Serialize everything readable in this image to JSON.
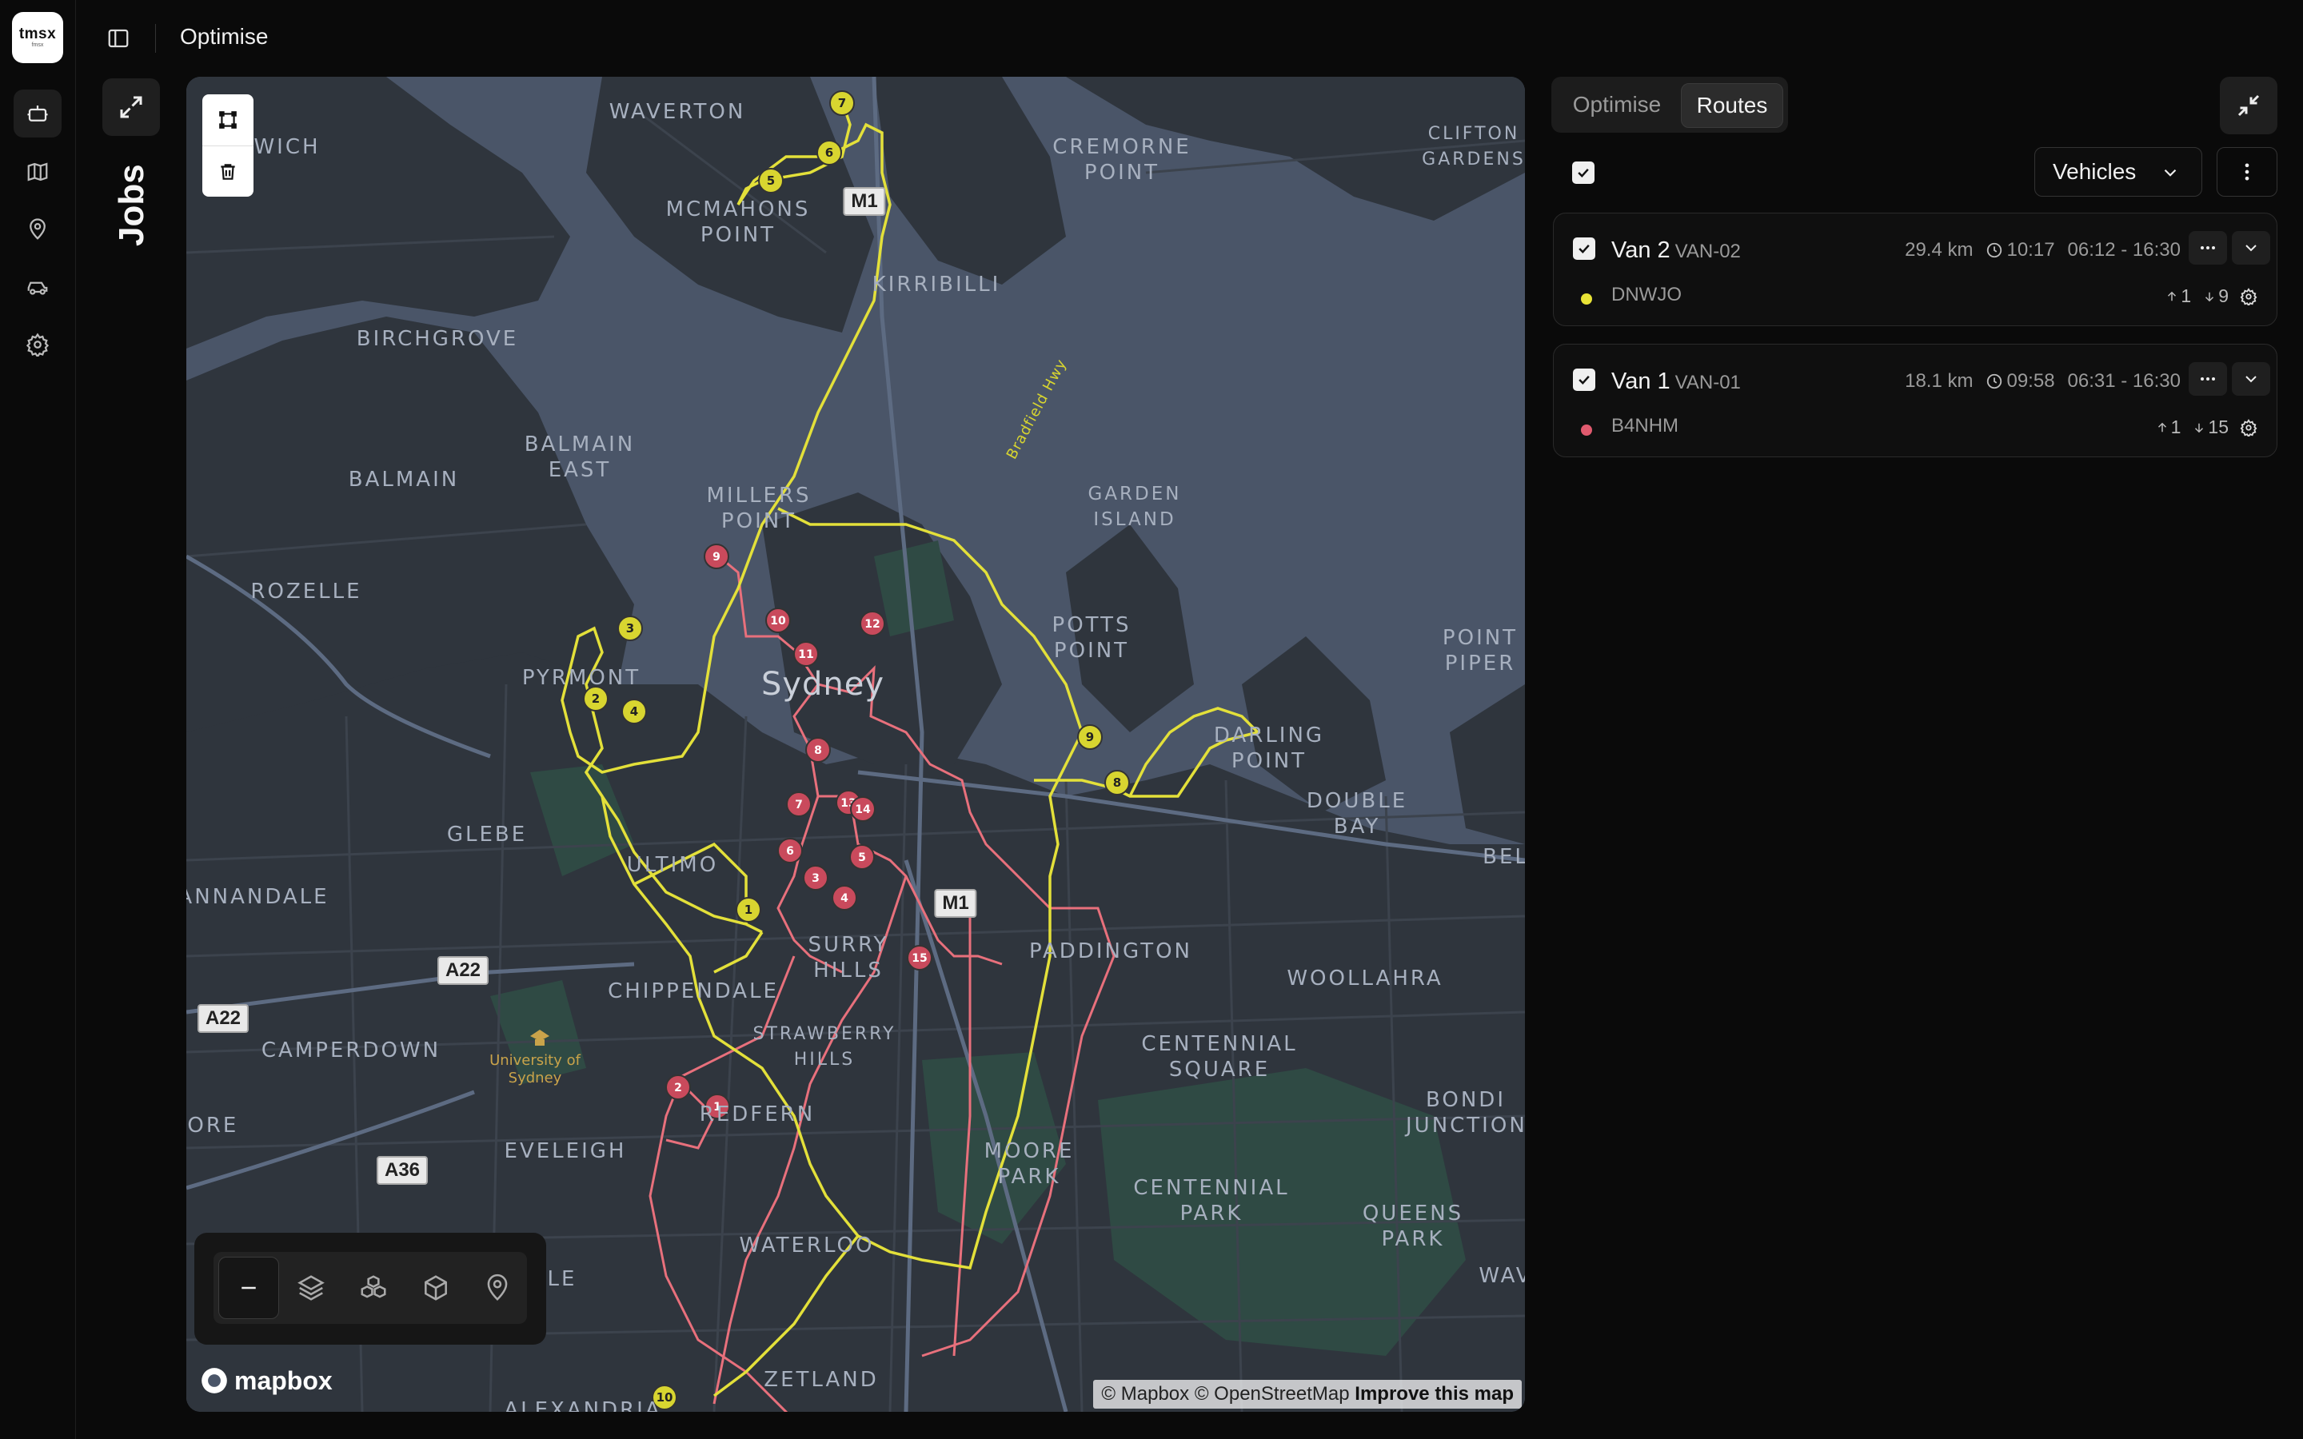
{
  "app": {
    "logo_text": "tmsx",
    "logo_sub": "fmsx"
  },
  "header": {
    "title": "Optimise"
  },
  "jobs": {
    "title": "Jobs"
  },
  "tabs": [
    {
      "label": "Optimise",
      "active": false
    },
    {
      "label": "Routes",
      "active": true
    }
  ],
  "vehicles_select": {
    "value": "Vehicles"
  },
  "routes": [
    {
      "name": "Van 2",
      "id": "VAN-02",
      "distance": "29.4 km",
      "duration": "10:17",
      "window": "06:12 - 16:30",
      "driver": "DNWJO",
      "color": "#e8e336",
      "pickups": "1",
      "drops": "9"
    },
    {
      "name": "Van 1",
      "id": "VAN-01",
      "distance": "18.1 km",
      "duration": "09:58",
      "window": "06:31 - 16:30",
      "driver": "B4NHM",
      "color": "#e05a6e",
      "pickups": "1",
      "drops": "15"
    }
  ],
  "map": {
    "labels": [
      "WAVERTON",
      "CREMORNE POINT",
      "CLIFTON GARDENS",
      "MCMAHONS POINT",
      "KIRRIBILLI",
      "BIRCHGROVE",
      "BALMAIN EAST",
      "BALMAIN",
      "MILLERS POINT",
      "GARDEN ISLAND",
      "ROZELLE",
      "POTTS POINT",
      "POINT PIPER",
      "PYRMONT",
      "Sydney",
      "DARLING POINT",
      "DOUBLE BAY",
      "GLEBE",
      "ULTIMO",
      "ANNANDALE",
      "SURRY HILLS",
      "PADDINGTON",
      "WOOLLAHRA",
      "CHIPPENDALE",
      "STRAWBERRY HILLS",
      "CAMPERDOWN",
      "CENTENNIAL SQUARE",
      "BONDI JUNCTION",
      "REDFERN",
      "EVELEIGH",
      "MOORE PARK",
      "CENTENNIAL PARK",
      "QUEENS PARK",
      "WATERLOO",
      "ZETLAND",
      "ALEXANDRIA",
      "WICH",
      "IORE",
      "BEL",
      "WAV",
      "LE",
      "University of Sydney",
      "Bradfield Hwy"
    ],
    "shields": [
      "M1",
      "M1",
      "A22",
      "A22",
      "A36"
    ],
    "van2_stops": [
      "1",
      "2",
      "3",
      "4",
      "5",
      "6",
      "7",
      "8",
      "9",
      "10"
    ],
    "van1_stops": [
      "1",
      "2",
      "3",
      "4",
      "5",
      "6",
      "7",
      "8",
      "9",
      "10",
      "11",
      "12",
      "13",
      "14",
      "15"
    ],
    "attribution": "© Mapbox © OpenStreetMap",
    "attribution_link": "Improve this map",
    "provider": "mapbox"
  },
  "colors": {
    "accent_yellow": "#e8e336",
    "accent_red": "#e05a6e",
    "water": "#4a5568",
    "land": "#2d333b"
  }
}
